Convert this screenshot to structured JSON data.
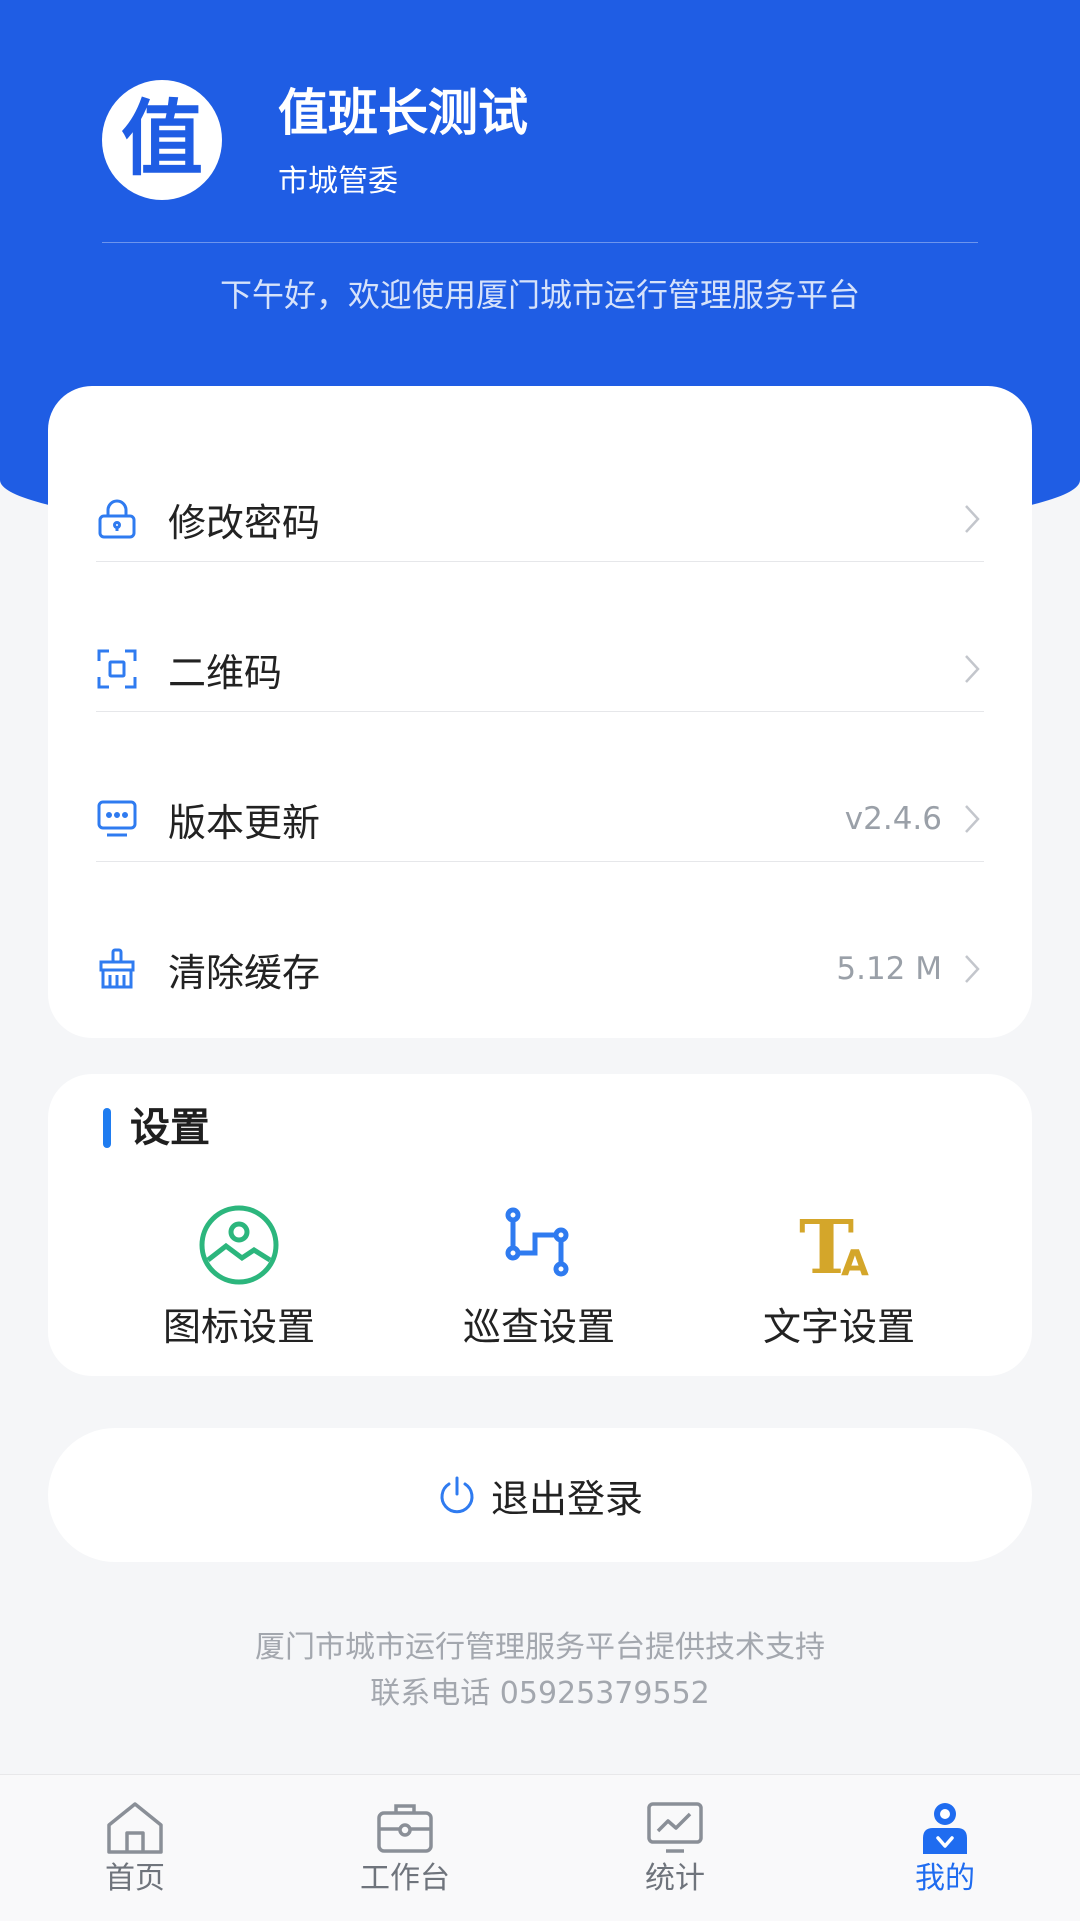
{
  "profile": {
    "avatar_char": "值",
    "name": "值班长测试",
    "department": "市城管委",
    "greeting": "下午好，欢迎使用厦门城市运行管理服务平台"
  },
  "menu": {
    "items": [
      {
        "label": "修改密码",
        "value": "",
        "icon": "lock-icon"
      },
      {
        "label": "二维码",
        "value": "",
        "icon": "qrcode-scan-icon"
      },
      {
        "label": "版本更新",
        "value": "v2.4.6",
        "icon": "monitor-update-icon"
      },
      {
        "label": "清除缓存",
        "value": "5.12 M",
        "icon": "brush-icon"
      }
    ]
  },
  "settings": {
    "title": "设置",
    "items": [
      {
        "label": "图标设置",
        "icon": "image-icon"
      },
      {
        "label": "巡查设置",
        "icon": "route-icon"
      },
      {
        "label": "文字设置",
        "icon": "text-size-icon"
      }
    ]
  },
  "logout": {
    "label": "退出登录",
    "icon": "power-icon"
  },
  "footer": {
    "support": "厦门市城市运行管理服务平台提供技术支持",
    "contact": "联系电话 05925379552"
  },
  "tabbar": {
    "items": [
      {
        "label": "首页",
        "icon": "home-icon",
        "active": false
      },
      {
        "label": "工作台",
        "icon": "briefcase-icon",
        "active": false
      },
      {
        "label": "统计",
        "icon": "chart-icon",
        "active": false
      },
      {
        "label": "我的",
        "icon": "user-icon",
        "active": true
      }
    ]
  },
  "colors": {
    "brand_blue": "#1f5de4",
    "accent_green": "#2cb67d",
    "accent_gold": "#d4a62a",
    "icon_blue": "#2f7bf0"
  }
}
